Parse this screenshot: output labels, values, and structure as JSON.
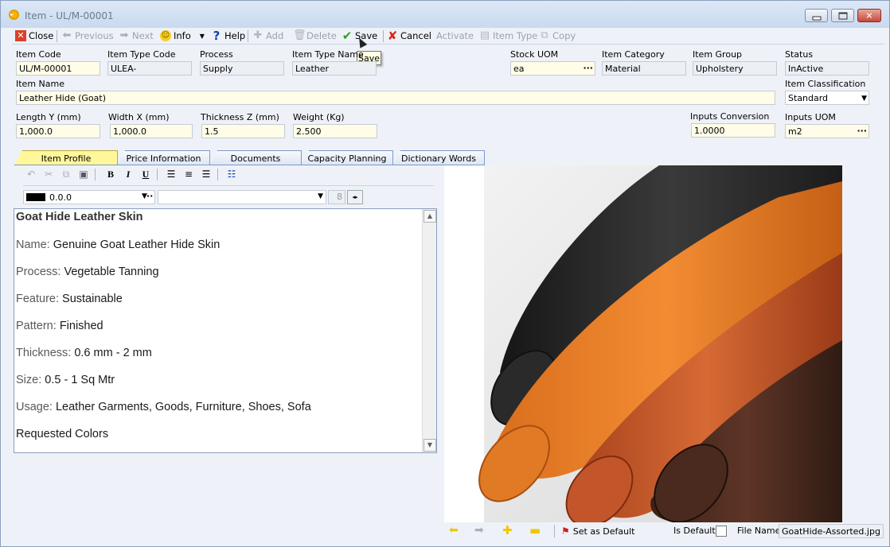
{
  "window": {
    "title": "Item - UL/M-00001"
  },
  "toolbar": {
    "close": "Close",
    "previous": "Previous",
    "next": "Next",
    "info": "Info",
    "help": "Help",
    "add": "Add",
    "delete": "Delete",
    "save": "Save",
    "cancel": "Cancel",
    "activate": "Activate",
    "item_type": "Item Type",
    "copy": "Copy",
    "tooltip": "Save"
  },
  "fields": {
    "item_code": {
      "label": "Item Code",
      "value": "UL/M-00001"
    },
    "item_type_code": {
      "label": "Item Type Code",
      "value": "ULEA-"
    },
    "process": {
      "label": "Process",
      "value": "Supply"
    },
    "item_type_name": {
      "label": "Item Type Name",
      "value": "Leather"
    },
    "stock_uom": {
      "label": "Stock UOM",
      "value": "ea"
    },
    "item_category": {
      "label": "Item Category",
      "value": "Material"
    },
    "item_group": {
      "label": "Item Group",
      "value": "Upholstery"
    },
    "status": {
      "label": "Status",
      "value": "InActive"
    },
    "item_name": {
      "label": "Item Name",
      "value": "Leather Hide (Goat)"
    },
    "item_classification": {
      "label": "Item Classification",
      "value": "Standard"
    },
    "length_y": {
      "label": "Length Y (mm)",
      "value": "1,000.0"
    },
    "width_x": {
      "label": "Width X (mm)",
      "value": "1,000.0"
    },
    "thickness_z": {
      "label": "Thickness Z (mm)",
      "value": "1.5"
    },
    "weight": {
      "label": "Weight (Kg)",
      "value": "2.500"
    },
    "inputs_conversion": {
      "label": "Inputs Conversion",
      "value": "1.0000"
    },
    "inputs_uom": {
      "label": "Inputs UOM",
      "value": "m2"
    }
  },
  "tabs": [
    "Item Profile",
    "Price Information",
    "Documents",
    "Capacity Planning",
    "Dictionary Words"
  ],
  "editor": {
    "color_value": "0.0.0",
    "font_size": "8",
    "heading": "Goat Hide Leather Skin",
    "lines": [
      {
        "key": "Name:",
        "val": "Genuine Goat Leather Hide Skin"
      },
      {
        "key": "Process:",
        "val": "Vegetable Tanning"
      },
      {
        "key": "Feature:",
        "val": "Sustainable"
      },
      {
        "key": "Pattern:",
        "val": "Finished"
      },
      {
        "key": "Thickness:",
        "val": "0.6 mm - 2 mm"
      },
      {
        "key": "Size:",
        "val": "0.5 - 1 Sq Mtr"
      },
      {
        "key": "Usage:",
        "val": "Leather Garments, Goods, Furniture, Shoes, Sofa"
      }
    ],
    "footer": "Requested Colors"
  },
  "image_panel": {
    "set_default": "Set as Default",
    "is_default_label": "Is Default",
    "file_name_label": "File Name",
    "file_name": "GoatHide-Assorted.jpg"
  },
  "colors": {
    "accent_yellow": "#fff799",
    "field_bg": "#fffde8"
  }
}
